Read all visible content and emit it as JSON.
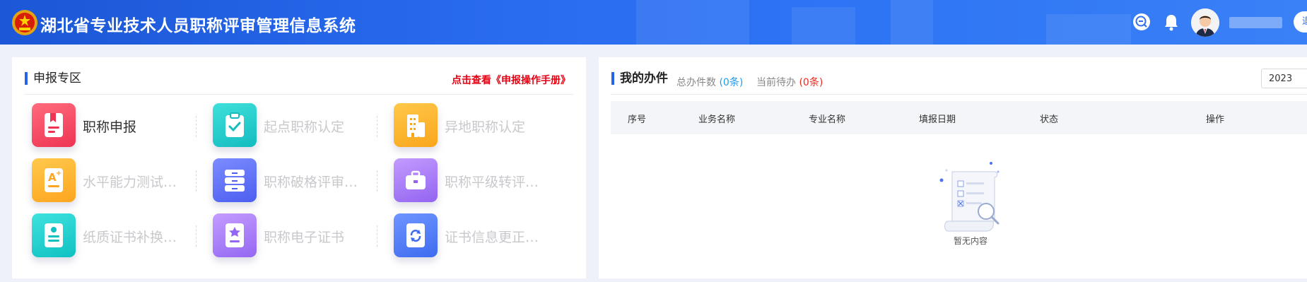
{
  "header": {
    "system_title": "湖北省专业技术人员职称评审管理信息系统",
    "username": "",
    "logout_label": "退"
  },
  "apply_section": {
    "title": "申报专区",
    "manual_link": "点击查看《申报操作手册》",
    "items": [
      {
        "label": "职称申报",
        "icon": "bookmark-doc-icon",
        "color": "#f2455f",
        "active": true
      },
      {
        "label": "起点职称认定",
        "icon": "clipboard-check-icon",
        "color": "#1ec8c6",
        "active": false
      },
      {
        "label": "异地职称认定",
        "icon": "building-icon",
        "color": "#fbb02a",
        "active": false
      },
      {
        "label": "水平能力测试免...",
        "icon": "grade-a-plus-icon",
        "color": "#fdb52d",
        "active": false
      },
      {
        "label": "职称破格评审申请",
        "icon": "cabinet-icon",
        "color": "#5b70f3",
        "active": false
      },
      {
        "label": "职称平级转评申请",
        "icon": "briefcase-icon",
        "color": "#a073f2",
        "active": false
      },
      {
        "label": "纸质证书补换申请",
        "icon": "certificate-doc-icon",
        "color": "#1ccbc9",
        "active": false
      },
      {
        "label": "职称电子证书",
        "icon": "badge-doc-icon",
        "color": "#a173f3",
        "active": false
      },
      {
        "label": "证书信息更正申请",
        "icon": "refresh-doc-icon",
        "color": "#4f7bf5",
        "active": false
      }
    ]
  },
  "my_tasks": {
    "title": "我的办件",
    "total_label": "总办件数",
    "total_value": "(0条)",
    "pending_label": "当前待办",
    "pending_value": "(0条)",
    "year": "2023",
    "columns": [
      "序号",
      "业务名称",
      "专业名称",
      "填报日期",
      "状态",
      "操作"
    ],
    "empty_text": "暂无内容"
  }
}
